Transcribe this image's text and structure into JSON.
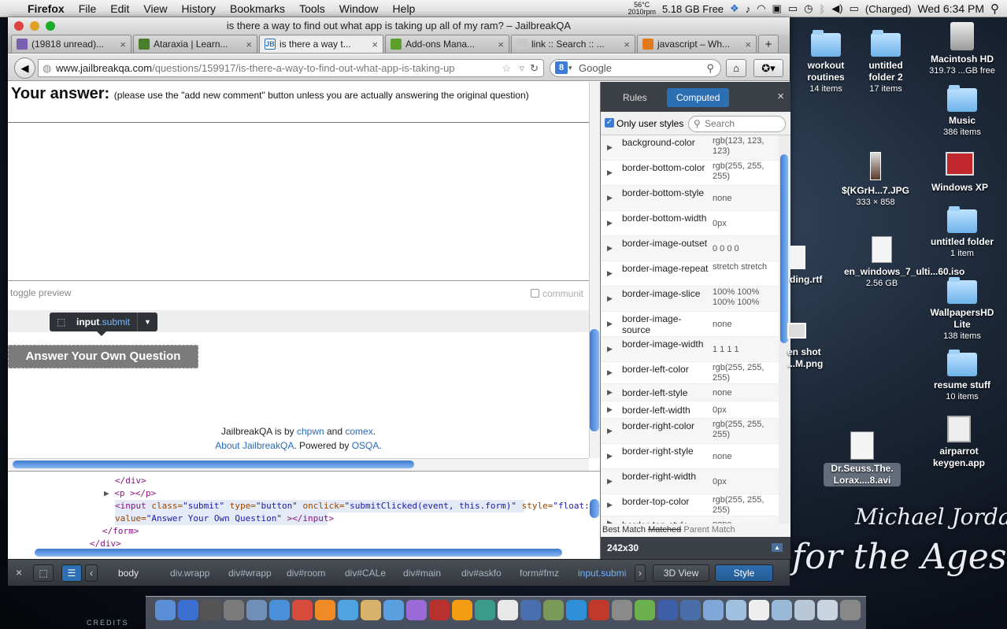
{
  "menubar": {
    "app": "Firefox",
    "items": [
      "File",
      "Edit",
      "View",
      "History",
      "Bookmarks",
      "Tools",
      "Window",
      "Help"
    ],
    "temp": "56°C",
    "rpm": "2010rpm",
    "memory": "5.18 GB Free",
    "battery": "(Charged)",
    "clock": "Wed 6:34 PM"
  },
  "window": {
    "title": "is there a way to find out what app is taking up all of my ram? – JailbreakQA"
  },
  "tabs": [
    {
      "label": "(19818 unread)...",
      "icon_color": "#7a5fb0"
    },
    {
      "label": "Ataraxia | Learn...",
      "icon_color": "#4a7d2c"
    },
    {
      "label": "is there a way t...",
      "icon_color": "#2b6cb8",
      "icon_text": "JB"
    },
    {
      "label": "Add-ons Mana...",
      "icon_color": "#5aa02c"
    },
    {
      "label": "link :: Search :: ...",
      "icon_color": "#c8c8c8"
    },
    {
      "label": "javascript – Wh...",
      "icon_color": "#e07a1c"
    }
  ],
  "nav": {
    "url_host": "www.jailbreakqa.com",
    "url_path": "/questions/159917/is-there-a-way-to-find-out-what-app-is-taking-up",
    "search_placeholder": "Google"
  },
  "page": {
    "answer_heading": "Your answer:",
    "answer_note": "(please use the \"add new comment\" button unless you are actually answering the original question)",
    "toggle_preview": "toggle preview",
    "community": "communit",
    "inspector_tag": "input",
    "inspector_class": ".submit",
    "submit_label": "Answer Your Own Question",
    "footer_line1_a": "JailbreakQA is by ",
    "footer_link1": "chpwn",
    "footer_and": " and ",
    "footer_link2": "comex",
    "footer_dot": ".",
    "footer_link3": "About JailbreakQA",
    "footer_powered": ". Powered by ",
    "footer_link4": "OSQA",
    "footer_end": "."
  },
  "html_panel": {
    "line0": "</div>",
    "line1": "<p  ></p>",
    "line2a": "<input",
    "line2_class_n": "class=",
    "line2_class_v": "\"submit\"",
    "line2_type_n": "type=",
    "line2_type_v": "\"button\"",
    "line2_onclick_n": "onclick=",
    "line2_onclick_v": "\"submitClicked(event, this.form)\"",
    "line2_style_n": "style=",
    "line2_style_v": "\"float:left\"",
    "line3_value_n": "value=",
    "line3_value_v": "\"Answer Your Own Question\"",
    "line3_end": "  ></input>",
    "line4": "</form>",
    "line5": "</div>"
  },
  "rules_panel": {
    "tab_rules": "Rules",
    "tab_computed": "Computed",
    "only_user_styles": "Only user styles",
    "search_placeholder": "Search",
    "properties": [
      {
        "name": "background-color",
        "value": "rgb(123, 123, 123)"
      },
      {
        "name": "border-bottom-color",
        "value": "rgb(255, 255, 255)"
      },
      {
        "name": "border-bottom-style",
        "value": "none"
      },
      {
        "name": "border-bottom-width",
        "value": "0px"
      },
      {
        "name": "border-image-outset",
        "value": "0 0 0 0"
      },
      {
        "name": "border-image-repeat",
        "value": "stretch stretch"
      },
      {
        "name": "border-image-slice",
        "value": "100% 100% 100% 100%"
      },
      {
        "name": "border-image-source",
        "value": "none"
      },
      {
        "name": "border-image-width",
        "value": "1 1 1 1"
      },
      {
        "name": "border-left-color",
        "value": "rgb(255, 255, 255)"
      },
      {
        "name": "border-left-style",
        "value": "none"
      },
      {
        "name": "border-left-width",
        "value": "0px"
      },
      {
        "name": "border-right-color",
        "value": "rgb(255, 255, 255)"
      },
      {
        "name": "border-right-style",
        "value": "none"
      },
      {
        "name": "border-right-width",
        "value": "0px"
      },
      {
        "name": "border-top-color",
        "value": "rgb(255, 255, 255)"
      },
      {
        "name": "border-top-style",
        "value": "none"
      }
    ],
    "footer_best": "Best Match",
    "footer_matched": "Matched",
    "footer_parent": "Parent Match",
    "dimensions": "242x30"
  },
  "devtools": {
    "crumbs": [
      "body",
      "div.wrapp",
      "div#wrapp",
      "div#room",
      "div#CALe",
      "div#main",
      "div#askfo",
      "form#fmz",
      "input.submi"
    ],
    "view3d": "3D View",
    "style": "Style"
  },
  "desktop": {
    "icons": [
      {
        "label": "workout routines",
        "sub": "14 items"
      },
      {
        "label": "untitled folder 2",
        "sub": "17 items"
      },
      {
        "label": "Macintosh HD",
        "sub": "319.73 ...GB free"
      },
      {
        "label": "Music",
        "sub": "386 items"
      },
      {
        "label": "$(KGrH...7.JPG",
        "sub": "333 × 858"
      },
      {
        "label": "Windows XP",
        "sub": ""
      },
      {
        "label": "untitled folder",
        "sub": "1 item"
      },
      {
        "label": "en_windows_7_ulti...60.iso",
        "sub": "2.56 GB"
      },
      {
        "label": "ding.rtf",
        "sub": ""
      },
      {
        "label": "WallpapersHD Lite",
        "sub": "138 items"
      },
      {
        "label": "en shot ...M.png",
        "sub": ""
      },
      {
        "label": "resume stuff",
        "sub": "10 items"
      },
      {
        "label": "Dr.Seuss.The. Lorax....8.avi",
        "sub": ""
      },
      {
        "label": "airparrot keygen.app",
        "sub": ""
      }
    ],
    "wallpaper_line1": "Michael Jordan",
    "wallpaper_line2": "for the Ages",
    "credits": "CREDITS"
  }
}
